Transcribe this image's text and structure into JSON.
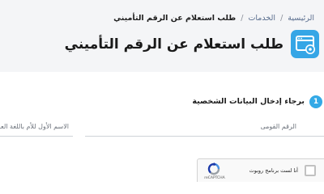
{
  "breadcrumb": {
    "home": "الرئيسية",
    "separator": "/",
    "services": "الخدمات",
    "current": "طلب استعلام عن الرقم التأميني"
  },
  "page": {
    "title": "طلب استعلام عن الرقم التأميني",
    "icon": "browser-settings-icon",
    "icon_color": "#36a6e6"
  },
  "step": {
    "number": "1",
    "label": "برجاء إدخال البيانات الشخصية",
    "badge_color": "#33a9e6"
  },
  "form": {
    "national_id_label": "الرقم القومى",
    "mother_first_name_label": "الاسم الأول للأم باللغة العر"
  },
  "recaptcha": {
    "label": "أنا لست برنامج روبوت",
    "brand": "reCAPTCHA",
    "icon": "recaptcha-logo-icon"
  },
  "colors": {
    "accent": "#36a6e6",
    "header_background": "#f4f5f7",
    "breadcrumb_link": "#5b6f8f"
  }
}
